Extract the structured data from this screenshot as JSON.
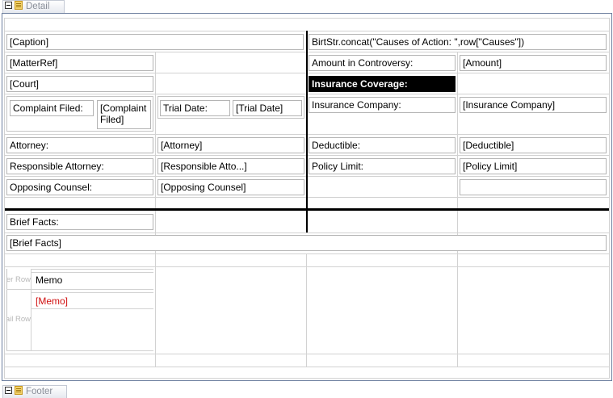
{
  "bands": {
    "detail": "Detail",
    "footer": "Footer"
  },
  "header": {
    "caption": "[Caption]",
    "causes_expression": "BirtStr.concat(\"Causes of Action:  \",row[\"Causes\"])"
  },
  "left_fields": {
    "matter_ref": "[MatterRef]",
    "court": "[Court]",
    "complaint_filed_label": "Complaint Filed:",
    "complaint_filed_value": "[Complaint Filed]",
    "trial_date_label": "Trial Date:",
    "trial_date_value": "[Trial Date]",
    "attorney_label": "Attorney:",
    "attorney_value": "[Attorney]",
    "responsible_attorney_label": "Responsible Attorney:",
    "responsible_attorney_value": "[Responsible Atto...]",
    "opposing_counsel_label": "Opposing Counsel:",
    "opposing_counsel_value": "[Opposing Counsel]"
  },
  "right_fields": {
    "amount_label": "Amount in Controversy:",
    "amount_value": "[Amount]",
    "insurance_coverage": "Insurance Coverage:",
    "insurance_company_label": "Insurance Company:",
    "insurance_company_value": "[Insurance Company]",
    "deductible_label": "Deductible:",
    "deductible_value": "[Deductible]",
    "policy_limit_label": "Policy Limit:",
    "policy_limit_value": "[Policy Limit]"
  },
  "brief": {
    "label": "Brief Facts:",
    "value": "[Brief Facts]"
  },
  "memo_table": {
    "header_row_label": "Header Row",
    "detail_row_label": "Detail Row",
    "header": "Memo",
    "value": "[Memo]"
  }
}
